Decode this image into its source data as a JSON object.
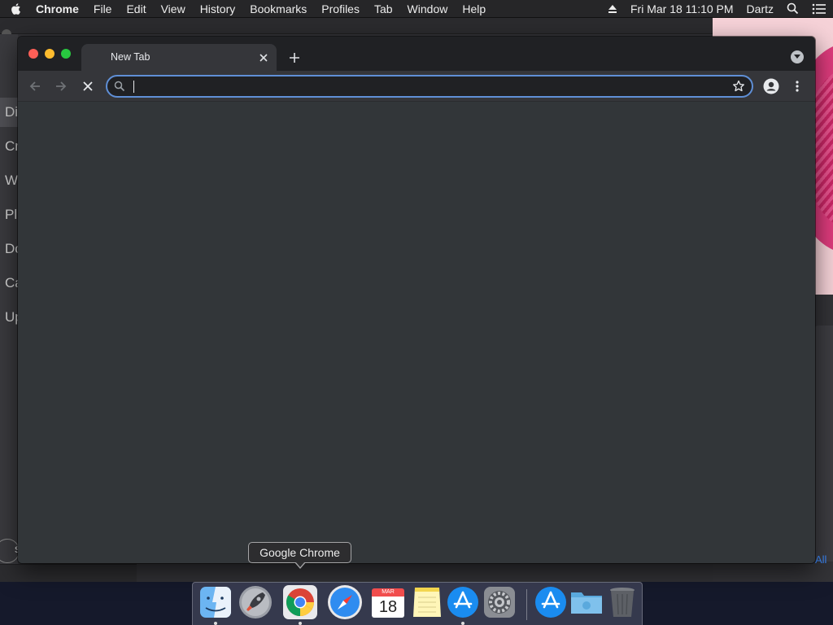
{
  "menubar": {
    "app_name": "Chrome",
    "items": [
      "File",
      "Edit",
      "View",
      "History",
      "Bookmarks",
      "Profiles",
      "Tab",
      "Window",
      "Help"
    ],
    "datetime": "Fri Mar 18  11:10 PM",
    "user": "Dartz"
  },
  "background_app": {
    "sidebar_labels": [
      "Di",
      "Cr",
      "W",
      "Pl",
      "Do",
      "Ca",
      "Up"
    ],
    "footer_label": "s",
    "link_all": "All"
  },
  "chrome": {
    "tab_title": "New Tab",
    "omnibox": {
      "value": "",
      "placeholder": ""
    },
    "colors": {
      "frame": "#202124",
      "toolbar": "#35363a",
      "content": "#323639",
      "focus_ring": "#5f8fd6"
    }
  },
  "tooltip": {
    "text": "Google Chrome"
  },
  "dock": {
    "items": [
      {
        "name": "Finder",
        "icon": "finder-icon",
        "running": true
      },
      {
        "name": "Launchpad",
        "icon": "rocket-icon",
        "running": false
      },
      {
        "name": "Google Chrome",
        "icon": "chrome-icon",
        "running": true
      },
      {
        "name": "Safari",
        "icon": "compass-icon",
        "running": false
      },
      {
        "name": "Calendar",
        "icon": "calendar-icon",
        "running": false
      },
      {
        "name": "Notes",
        "icon": "notes-icon",
        "running": false
      },
      {
        "name": "App Store",
        "icon": "app-store-icon",
        "running": true
      },
      {
        "name": "System Preferences",
        "icon": "gear-icon",
        "running": false
      },
      {
        "name": "Applications",
        "icon": "app-store-icon",
        "running": false
      },
      {
        "name": "Downloads",
        "icon": "folder-icon",
        "running": false
      },
      {
        "name": "Trash",
        "icon": "trash-icon",
        "running": false
      }
    ],
    "calendar": {
      "month": "MAR",
      "day": "18"
    }
  }
}
